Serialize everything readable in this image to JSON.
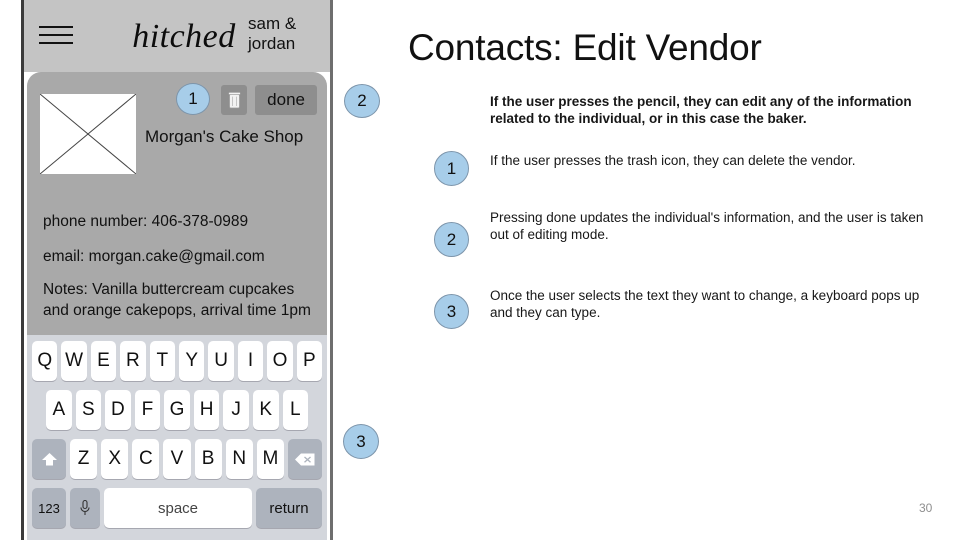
{
  "slide": {
    "title": "Contacts: Edit Vendor",
    "page_number": "30"
  },
  "phone": {
    "header": {
      "menu_icon": "hamburger-icon",
      "brand": "hitched",
      "couple": "sam & jordan"
    },
    "card": {
      "avatar_icon": "image-placeholder-icon",
      "trash_icon": "trash-icon",
      "done_label": "done",
      "vendor_name": "Morgan's Cake Shop",
      "phone_line": "phone number: 406-378-0989",
      "email_line": "email: morgan.cake@gmail.com",
      "notes_line": "Notes: Vanilla buttercream cupcakes and orange cakepops, arrival time 1pm"
    },
    "keyboard": {
      "row1": [
        "Q",
        "W",
        "E",
        "R",
        "T",
        "Y",
        "U",
        "I",
        "O",
        "P"
      ],
      "row2": [
        "A",
        "S",
        "D",
        "F",
        "G",
        "H",
        "J",
        "K",
        "L"
      ],
      "row3_letters": [
        "Z",
        "X",
        "C",
        "V",
        "B",
        "N",
        "M"
      ],
      "shift_icon": "shift-arrow-icon",
      "backspace_icon": "backspace-icon",
      "numeric_label": "123",
      "mic_icon": "microphone-icon",
      "space_label": "space",
      "return_label": "return"
    }
  },
  "callouts": {
    "on_phone": {
      "pencil": "1",
      "done": "2",
      "keyboard": "3"
    },
    "notes": [
      {
        "badge": "1",
        "text": "If the user presses the trash icon, they can delete the vendor."
      },
      {
        "badge": "2",
        "text": "Pressing done updates the individual's information, and the user is taken out of editing mode."
      },
      {
        "badge": "3",
        "text": "Once the user selects the text they want to change, a keyboard pops up and they can type."
      }
    ],
    "intro": "If the user presses the pencil, they can edit any of the information related to the individual, or in this case the baker."
  },
  "colors": {
    "badge_fill": "#a7cde9",
    "badge_border": "#7d95ab",
    "header_bar": "#c4c4c4",
    "card_bg": "#a9a9a9",
    "keyboard_bg": "#d3d6dc",
    "key_fn": "#adb3bd"
  }
}
